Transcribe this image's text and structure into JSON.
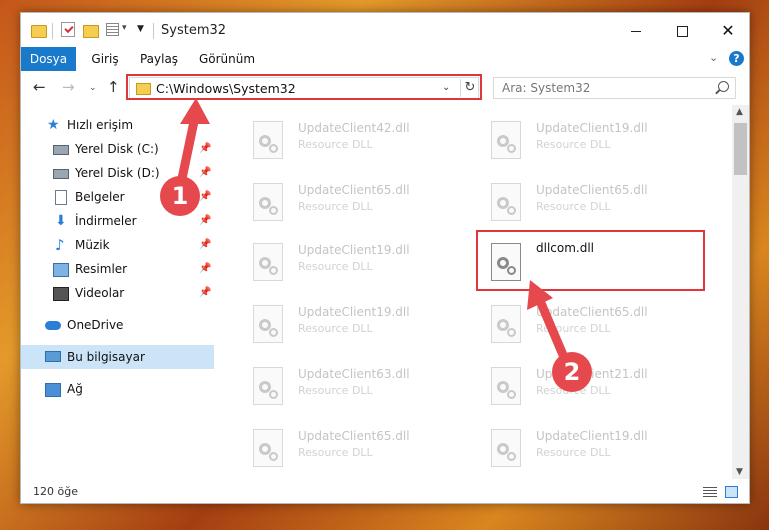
{
  "window": {
    "title": "System32"
  },
  "ribbon": {
    "tabs": [
      "Dosya",
      "Giriş",
      "Paylaş",
      "Görünüm"
    ]
  },
  "address": {
    "path": "C:\\Windows\\System32"
  },
  "search": {
    "placeholder": "Ara: System32"
  },
  "nav": {
    "items": [
      {
        "label": "Hızlı erişim",
        "icon": "star-icon"
      },
      {
        "label": "Yerel Disk (C:)",
        "icon": "drive-icon",
        "pinned": true
      },
      {
        "label": "Yerel Disk (D:)",
        "icon": "drive-icon",
        "pinned": true
      },
      {
        "label": "Belgeler",
        "icon": "documents-icon",
        "pinned": true
      },
      {
        "label": "İndirmeler",
        "icon": "download-icon",
        "pinned": true
      },
      {
        "label": "Müzik",
        "icon": "music-icon",
        "pinned": true
      },
      {
        "label": "Resimler",
        "icon": "pictures-icon",
        "pinned": true
      },
      {
        "label": "Videolar",
        "icon": "videos-icon",
        "pinned": true
      },
      {
        "label": "OneDrive",
        "icon": "cloud-icon"
      },
      {
        "label": "Bu bilgisayar",
        "icon": "computer-icon",
        "selected": true
      },
      {
        "label": "Ağ",
        "icon": "network-icon"
      }
    ]
  },
  "files": [
    {
      "name": "UpdateClient42.dll",
      "type": "Resource DLL"
    },
    {
      "name": "UpdateClient19.dll",
      "type": "Resource DLL"
    },
    {
      "name": "UpdateClient65.dll",
      "type": "Resource DLL"
    },
    {
      "name": "UpdateClient65.dll",
      "type": "Resource DLL"
    },
    {
      "name": "UpdateClient19.dll",
      "type": "Resource DLL"
    },
    {
      "name": "dllcom.dll",
      "type": "",
      "highlighted": true
    },
    {
      "name": "UpdateClient19.dll",
      "type": "Resource DLL"
    },
    {
      "name": "UpdateClient65.dll",
      "type": "Resource DLL"
    },
    {
      "name": "UpdateClient63.dll",
      "type": "Resource DLL"
    },
    {
      "name": "UpdateClient21.dll",
      "type": "Resource DLL"
    },
    {
      "name": "UpdateClient65.dll",
      "type": "Resource DLL"
    },
    {
      "name": "UpdateClient19.dll",
      "type": "Resource DLL"
    }
  ],
  "status": {
    "count": "120 öğe"
  },
  "annotations": {
    "step1": "1",
    "step2": "2",
    "color": "#e0353b"
  }
}
